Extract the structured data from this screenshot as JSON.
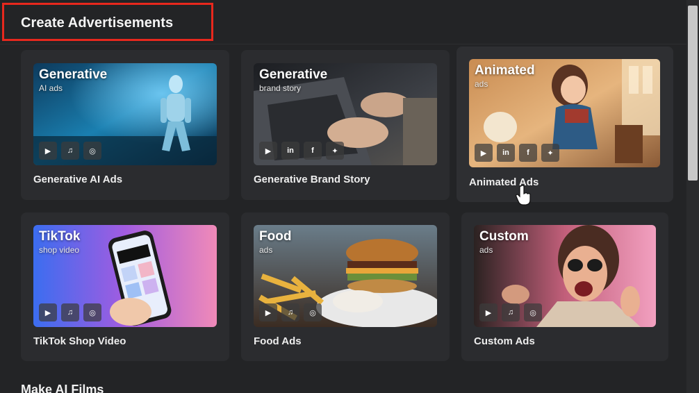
{
  "header": {
    "title": "Create Advertisements"
  },
  "cards": [
    {
      "thumb_title": "Generative",
      "thumb_sub": "AI ads",
      "label": "Generative AI Ads",
      "icons": [
        "video-icon",
        "music-icon",
        "instagram-icon"
      ]
    },
    {
      "thumb_title": "Generative",
      "thumb_sub": "brand story",
      "label": "Generative Brand Story",
      "icons": [
        "video-icon",
        "linkedin-icon",
        "facebook-icon",
        "twitter-icon"
      ]
    },
    {
      "thumb_title": "Animated",
      "thumb_sub": "ads",
      "label": "Animated Ads",
      "icons": [
        "video-icon",
        "linkedin-icon",
        "facebook-icon",
        "twitter-icon"
      ]
    },
    {
      "thumb_title": "TikTok",
      "thumb_sub": "shop video",
      "label": "TikTok Shop Video",
      "icons": [
        "video-icon",
        "music-icon",
        "instagram-icon"
      ]
    },
    {
      "thumb_title": "Food",
      "thumb_sub": "ads",
      "label": "Food Ads",
      "icons": [
        "video-icon",
        "music-icon",
        "instagram-icon"
      ]
    },
    {
      "thumb_title": "Custom",
      "thumb_sub": "ads",
      "label": "Custom Ads",
      "icons": [
        "video-icon",
        "music-icon",
        "instagram-icon"
      ]
    }
  ],
  "section2": {
    "title": "Make AI Films"
  },
  "colors": {
    "background": "#232426",
    "card": "#2b2c2f",
    "highlight": "#e8281d"
  }
}
